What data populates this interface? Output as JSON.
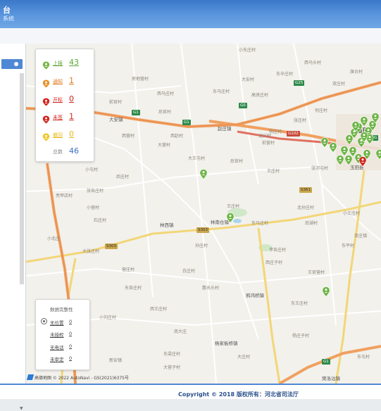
{
  "header": {
    "title_fragment": "台",
    "subtitle_fragment": "系统"
  },
  "stats": [
    {
      "label": "上报",
      "value": "43",
      "color": "#5aa832",
      "pin": "#7ab648",
      "underline": true
    },
    {
      "label": "通知",
      "value": "1",
      "color": "#e07a1a",
      "pin": "#e8902a",
      "underline": true
    },
    {
      "label": "开标",
      "value": "0",
      "color": "#d0261e",
      "pin": "#d0261e",
      "underline": true
    },
    {
      "label": "未签",
      "value": "1",
      "color": "#d0261e",
      "pin": "#d0261e",
      "underline": true
    },
    {
      "label": "撤回",
      "value": "0",
      "color": "#e8b81a",
      "pin": "#f0c828",
      "underline": true
    },
    {
      "label": "总数",
      "value": "46",
      "color": "#3a6fc0",
      "pin": null,
      "underline": false
    }
  ],
  "integrity": {
    "title": "数据完整性",
    "rows": [
      {
        "label": "无位置",
        "value": "0"
      },
      {
        "label": "未授权",
        "value": "0"
      },
      {
        "label": "无电话",
        "value": "0"
      },
      {
        "label": "未审定",
        "value": "0"
      }
    ]
  },
  "map": {
    "attribution": "高德地图 © 2022 AutoNavi - GS(2021)6375号",
    "labels": [
      {
        "t": "小东庄村",
        "c": "lbl"
      },
      {
        "t": "西马头村",
        "c": "lbl"
      },
      {
        "t": "大安村",
        "c": "lbl"
      },
      {
        "t": "东辛庄村",
        "c": "lbl"
      },
      {
        "t": "房地营村",
        "c": "lbl"
      },
      {
        "t": "西马庄村",
        "c": "lbl"
      },
      {
        "t": "东马庄村",
        "c": "lbl"
      },
      {
        "t": "高贤庄村",
        "c": "lbl"
      },
      {
        "t": "双庄村",
        "c": "lbl"
      },
      {
        "t": "旗台村",
        "c": "lbl"
      },
      {
        "t": "何庄村",
        "c": "lbl"
      },
      {
        "t": "张庄村",
        "c": "lbl"
      },
      {
        "t": "前官村",
        "c": "lbl"
      },
      {
        "t": "后官村",
        "c": "lbl"
      },
      {
        "t": "大安镇",
        "c": "lbl town"
      },
      {
        "t": "西营村",
        "c": "lbl"
      },
      {
        "t": "大营村",
        "c": "lbl"
      },
      {
        "t": "西赵村",
        "c": "lbl"
      },
      {
        "t": "龙兴村",
        "c": "lbl"
      },
      {
        "t": "赵庄镇",
        "c": "lbl town"
      },
      {
        "t": "杨庄村",
        "c": "lbl"
      },
      {
        "t": "前营村",
        "c": "lbl"
      },
      {
        "t": "玉田",
        "c": "lbl big"
      },
      {
        "t": "玉田县",
        "c": "lbl town"
      },
      {
        "t": "大王屯村",
        "c": "lbl"
      },
      {
        "t": "后官村",
        "c": "lbl"
      },
      {
        "t": "王庄村",
        "c": "lbl"
      },
      {
        "t": "张河屯村",
        "c": "lbl"
      },
      {
        "t": "小屯村",
        "c": "lbl"
      },
      {
        "t": "后庄村",
        "c": "lbl"
      },
      {
        "t": "张各庄村",
        "c": "lbl"
      },
      {
        "t": "亮甲店村",
        "c": "lbl"
      },
      {
        "t": "小营村",
        "c": "lbl"
      },
      {
        "t": "林南仓镇",
        "c": "lbl town"
      },
      {
        "t": "王庄村",
        "c": "lbl"
      },
      {
        "t": "北孙庄村",
        "c": "lbl"
      },
      {
        "t": "小王庄村",
        "c": "lbl"
      },
      {
        "t": "石庄村",
        "c": "lbl"
      },
      {
        "t": "后湖村",
        "c": "lbl"
      },
      {
        "t": "东马庄村",
        "c": "lbl"
      },
      {
        "t": "林西镇",
        "c": "lbl town"
      },
      {
        "t": "孙庄村",
        "c": "lbl"
      },
      {
        "t": "小北庄",
        "c": "lbl"
      },
      {
        "t": "鸦鸿桥镇",
        "c": "lbl town"
      },
      {
        "t": "大张庄村",
        "c": "lbl"
      },
      {
        "t": "李各庄村",
        "c": "lbl"
      },
      {
        "t": "西庄子村",
        "c": "lbl"
      },
      {
        "t": "双庄镇",
        "c": "lbl"
      },
      {
        "t": "王官营村",
        "c": "lbl"
      },
      {
        "t": "东平村",
        "c": "lbl"
      },
      {
        "t": "营庄村",
        "c": "lbl"
      },
      {
        "t": "白庄村",
        "c": "lbl"
      },
      {
        "t": "杨家板桥镇",
        "c": "lbl town"
      },
      {
        "t": "东各庄村",
        "c": "lbl"
      },
      {
        "t": "散水头村",
        "c": "lbl"
      },
      {
        "t": "新安镇",
        "c": "lbl"
      },
      {
        "t": "大营子村",
        "c": "lbl"
      },
      {
        "t": "东梁庄村",
        "c": "lbl"
      },
      {
        "t": "西王庄村",
        "c": "lbl"
      },
      {
        "t": "东王庄村",
        "c": "lbl"
      },
      {
        "t": "小刘庄村",
        "c": "lbl"
      },
      {
        "t": "大庄村",
        "c": "lbl"
      },
      {
        "t": "杨庄子村",
        "c": "lbl"
      },
      {
        "t": "东屯村",
        "c": "lbl"
      },
      {
        "t": "南大庄",
        "c": "lbl"
      },
      {
        "t": "窝洛沽镇",
        "c": "lbl town"
      }
    ],
    "shields": [
      {
        "t": "G1",
        "c": "g"
      },
      {
        "t": "G25",
        "c": "g"
      },
      {
        "t": "G0",
        "c": "g"
      },
      {
        "t": "G1",
        "c": "g"
      },
      {
        "t": "G102",
        "c": "r"
      },
      {
        "t": "S303",
        "c": "y"
      },
      {
        "t": "S303",
        "c": "y"
      },
      {
        "t": "S361",
        "c": "y"
      },
      {
        "t": "G1",
        "c": "g"
      },
      {
        "t": "G",
        "c": "g"
      }
    ],
    "road_names": [
      "京哈高速",
      "京哈公路",
      "京沈高速",
      "津蓟高速",
      "唐津高速"
    ]
  },
  "footer": {
    "text": "Copyright © 2018 版权所有：河北省司法厅"
  }
}
